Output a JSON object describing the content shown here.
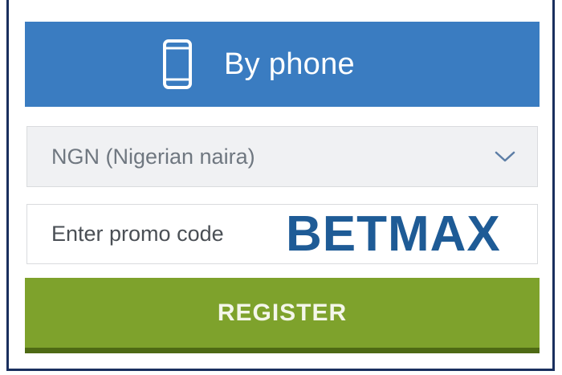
{
  "registration_form": {
    "phone_tab": {
      "icon": "smartphone-icon",
      "label": "By phone",
      "color": "#3a7cc1"
    },
    "currency_select": {
      "value": "NGN (Nigerian naira)",
      "icon": "chevron-down-icon"
    },
    "promo_field": {
      "placeholder": "Enter promo code",
      "code_overlay": "BETMAX",
      "code_color": "#1e5b96"
    },
    "register_button": {
      "label": "REGISTER",
      "color": "#7ea22c"
    }
  }
}
